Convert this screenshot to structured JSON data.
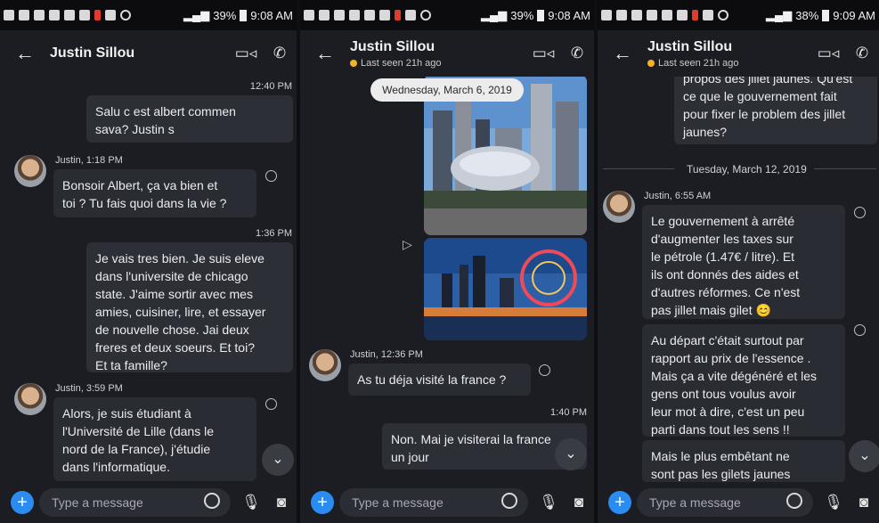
{
  "panels": [
    {
      "status": {
        "battery": "39%",
        "time": "9:08 AM"
      },
      "header": {
        "title": "Justin Sillou",
        "subtitle": ""
      },
      "messages": {
        "ts1": "12:40 PM",
        "out1": "Salu c est albert commen\nsava? Justin s",
        "sender1": "Justin, 1:18 PM",
        "in1": "Bonsoir Albert, ça va bien et\ntoi ? Tu fais quoi dans la vie ?",
        "ts2": "1:36 PM",
        "out2": "Je vais tres bien. Je suis eleve\ndans l'universite de chicago\nstate. J'aime sortir avec mes\namies, cuisiner, lire, et essayer\nde nouvelle chose. Jai deux\nfreres et deux soeurs. Et toi?\nEt ta famille?",
        "sender2": "Justin, 3:59 PM",
        "in2": "Alors, je suis étudiant à\nl'Université de Lille (dans le\nnord de la France), j'étudie\ndans l'informatique."
      },
      "input": {
        "placeholder": "Type a message"
      }
    },
    {
      "status": {
        "battery": "39%",
        "time": "9:08 AM"
      },
      "header": {
        "title": "Justin Sillou",
        "subtitle": "Last seen 21h ago"
      },
      "messages": {
        "date": "Wednesday, March 6, 2019",
        "sender1": "Justin, 12:36 PM",
        "in1": "As tu déja visité la france ?",
        "ts1": "1:40 PM",
        "out1": "Non. Mai je visiterai la france\nun jour"
      },
      "input": {
        "placeholder": "Type a message"
      }
    },
    {
      "status": {
        "battery": "38%",
        "time": "9:09 AM"
      },
      "header": {
        "title": "Justin Sillou",
        "subtitle": "Last seen 21h ago"
      },
      "messages": {
        "out1": "propos des jillet jaunes. Qu'est\nce que le gouvernement fait\npour fixer le problem des jillet\njaunes?",
        "date": "Tuesday, March 12, 2019",
        "sender1": "Justin, 6:55 AM",
        "in1": "Le gouvernement à arrêté\nd'augmenter les taxes sur\nle pétrole (1.47€ / litre). Et\nils ont donnés des aides et\nd'autres réformes. Ce n'est\npas jillet mais gilet 😊",
        "in2": "Au départ c'était surtout par\nrapport au prix de l'essence .\nMais ça a vite dégénéré et les\ngens ont tous voulus avoir\nleur mot à dire, c'est un peu\nparti dans tout les sens !!",
        "in3": "Mais le plus embêtant ne\nsont pas les gilets jaunes"
      },
      "input": {
        "placeholder": "Type a message"
      }
    }
  ]
}
